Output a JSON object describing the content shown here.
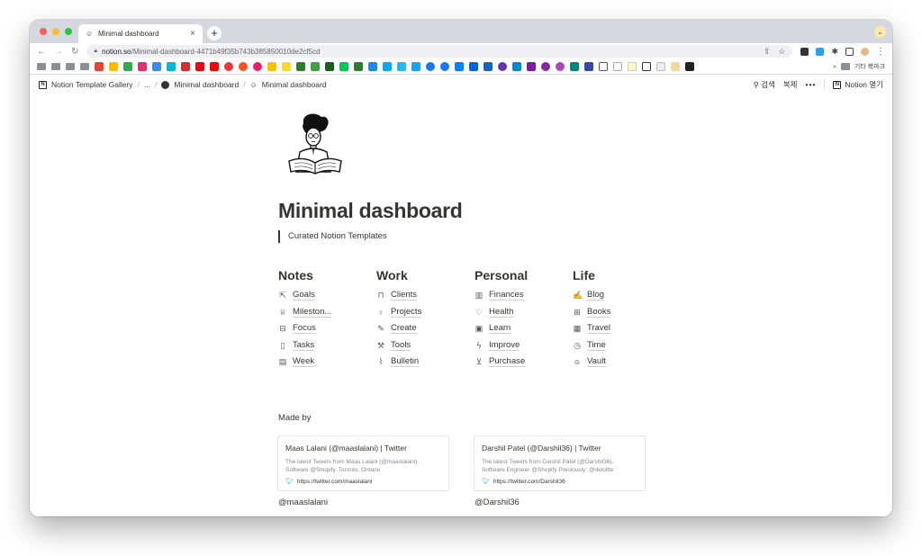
{
  "browser": {
    "tab_title": "Minimal dashboard",
    "tab_close": "×",
    "new_tab": "+",
    "url_host": "notion.so",
    "url_path": "/Minimal-dashboard-4471b49f35b743b385850010de2cf5cd",
    "other_bookmarks": "기타 북마크"
  },
  "topbar": {
    "breadcrumb": [
      "Notion Template Gallery",
      "...",
      "Minimal dashboard",
      "Minimal dashboard"
    ],
    "search_label": "검색",
    "duplicate_label": "복제",
    "more_label": "•••",
    "open_label": "Notion 열기"
  },
  "page": {
    "title": "Minimal dashboard",
    "quote": "Curated Notion Templates",
    "columns": [
      {
        "heading": "Notes",
        "links": [
          {
            "label": "Goals",
            "icon": "cursor-icon"
          },
          {
            "label": "Mileston...",
            "icon": "trophy-icon"
          },
          {
            "label": "Focus",
            "icon": "inbox-icon"
          },
          {
            "label": "Tasks",
            "icon": "clipboard-icon"
          },
          {
            "label": "Week",
            "icon": "calendar-icon"
          }
        ]
      },
      {
        "heading": "Work",
        "links": [
          {
            "label": "Clients",
            "icon": "briefcase-icon"
          },
          {
            "label": "Projects",
            "icon": "lightbulb-icon"
          },
          {
            "label": "Create",
            "icon": "pencil-icon"
          },
          {
            "label": "Tools",
            "icon": "wrench-icon"
          },
          {
            "label": "Bulletin",
            "icon": "paperclip-icon"
          }
        ]
      },
      {
        "heading": "Personal",
        "links": [
          {
            "label": "Finances",
            "icon": "bar-chart-icon"
          },
          {
            "label": "Health",
            "icon": "heart-icon"
          },
          {
            "label": "Learn",
            "icon": "save-icon"
          },
          {
            "label": "Improve",
            "icon": "lightning-icon"
          },
          {
            "label": "Purchase",
            "icon": "cart-icon"
          }
        ]
      },
      {
        "heading": "Life",
        "links": [
          {
            "label": "Blog",
            "icon": "edit-icon"
          },
          {
            "label": "Books",
            "icon": "book-icon"
          },
          {
            "label": "Travel",
            "icon": "map-icon"
          },
          {
            "label": "Time",
            "icon": "clock-icon"
          },
          {
            "label": "Vault",
            "icon": "lock-icon"
          }
        ]
      }
    ],
    "made_by": "Made by",
    "cards": [
      {
        "title": "Maas Lalani (@maaslalani) | Twitter",
        "desc1": "The latest Tweets from Maas Lalani (@maaslalani).",
        "desc2": "Software @Shopify. Toronto, Ontario",
        "url": "https://twitter.com/maaslalani",
        "handle": "@maaslalani"
      },
      {
        "title": "Darshil Patel (@Darshil36) | Twitter",
        "desc1": "The latest Tweets from Darshil Patel (@Darshil36).",
        "desc2": "Software Engineer @Shopify Previously: @deloitte",
        "url": "https://twitter.com/Darshil36",
        "handle": "@Darshil36"
      }
    ]
  },
  "colors": {
    "text": "#37352f",
    "twitter": "#1d9bf0",
    "tab_bar": "#d6d8df"
  }
}
